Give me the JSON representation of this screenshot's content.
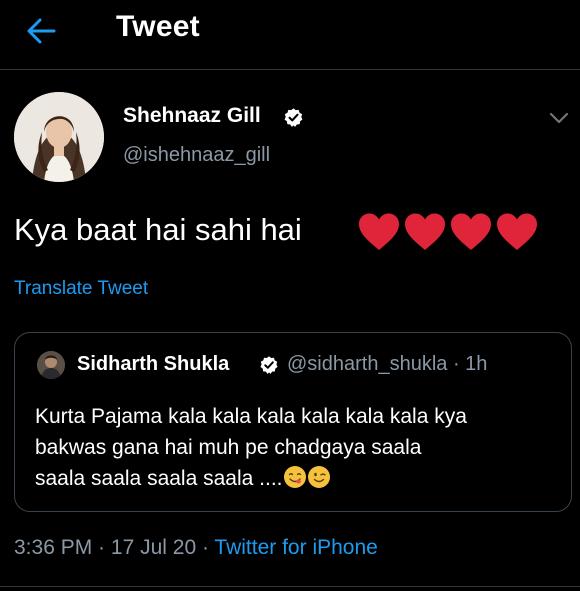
{
  "header": {
    "title": "Tweet",
    "back_icon": "arrow-left-icon",
    "accent": "#1d9bf0"
  },
  "tweet": {
    "author": {
      "name": "Shehnaaz Gill",
      "handle": "@ishehnaaz_gill",
      "verified": true
    },
    "text": "Kya baat hai sahi hai",
    "emojis": [
      "heart-icon",
      "heart-icon",
      "heart-icon",
      "heart-icon"
    ],
    "heart_color": "#e0243a",
    "translate_label": "Translate Tweet",
    "time": "3:36 PM",
    "date": "17 Jul 20",
    "source": "Twitter for iPhone",
    "separator": " · "
  },
  "quoted_tweet": {
    "author": {
      "name": "Sidharth Shukla",
      "handle": "@sidharth_shukla",
      "verified": true
    },
    "age": "1h",
    "meta_separator": " · ",
    "text": "Kurta Pajama kala  kala kala kala kala kala kya\nbakwas gana hai muh pe chadgaya  saala\nsaala saala saala saala ....",
    "emojis": [
      "face-savoring-food-icon",
      "winking-face-icon"
    ]
  },
  "colors": {
    "background": "#000000",
    "primary_text": "#ffffff",
    "secondary_text": "#8b98a5",
    "link": "#1d9bf0",
    "border": "#38444d"
  }
}
